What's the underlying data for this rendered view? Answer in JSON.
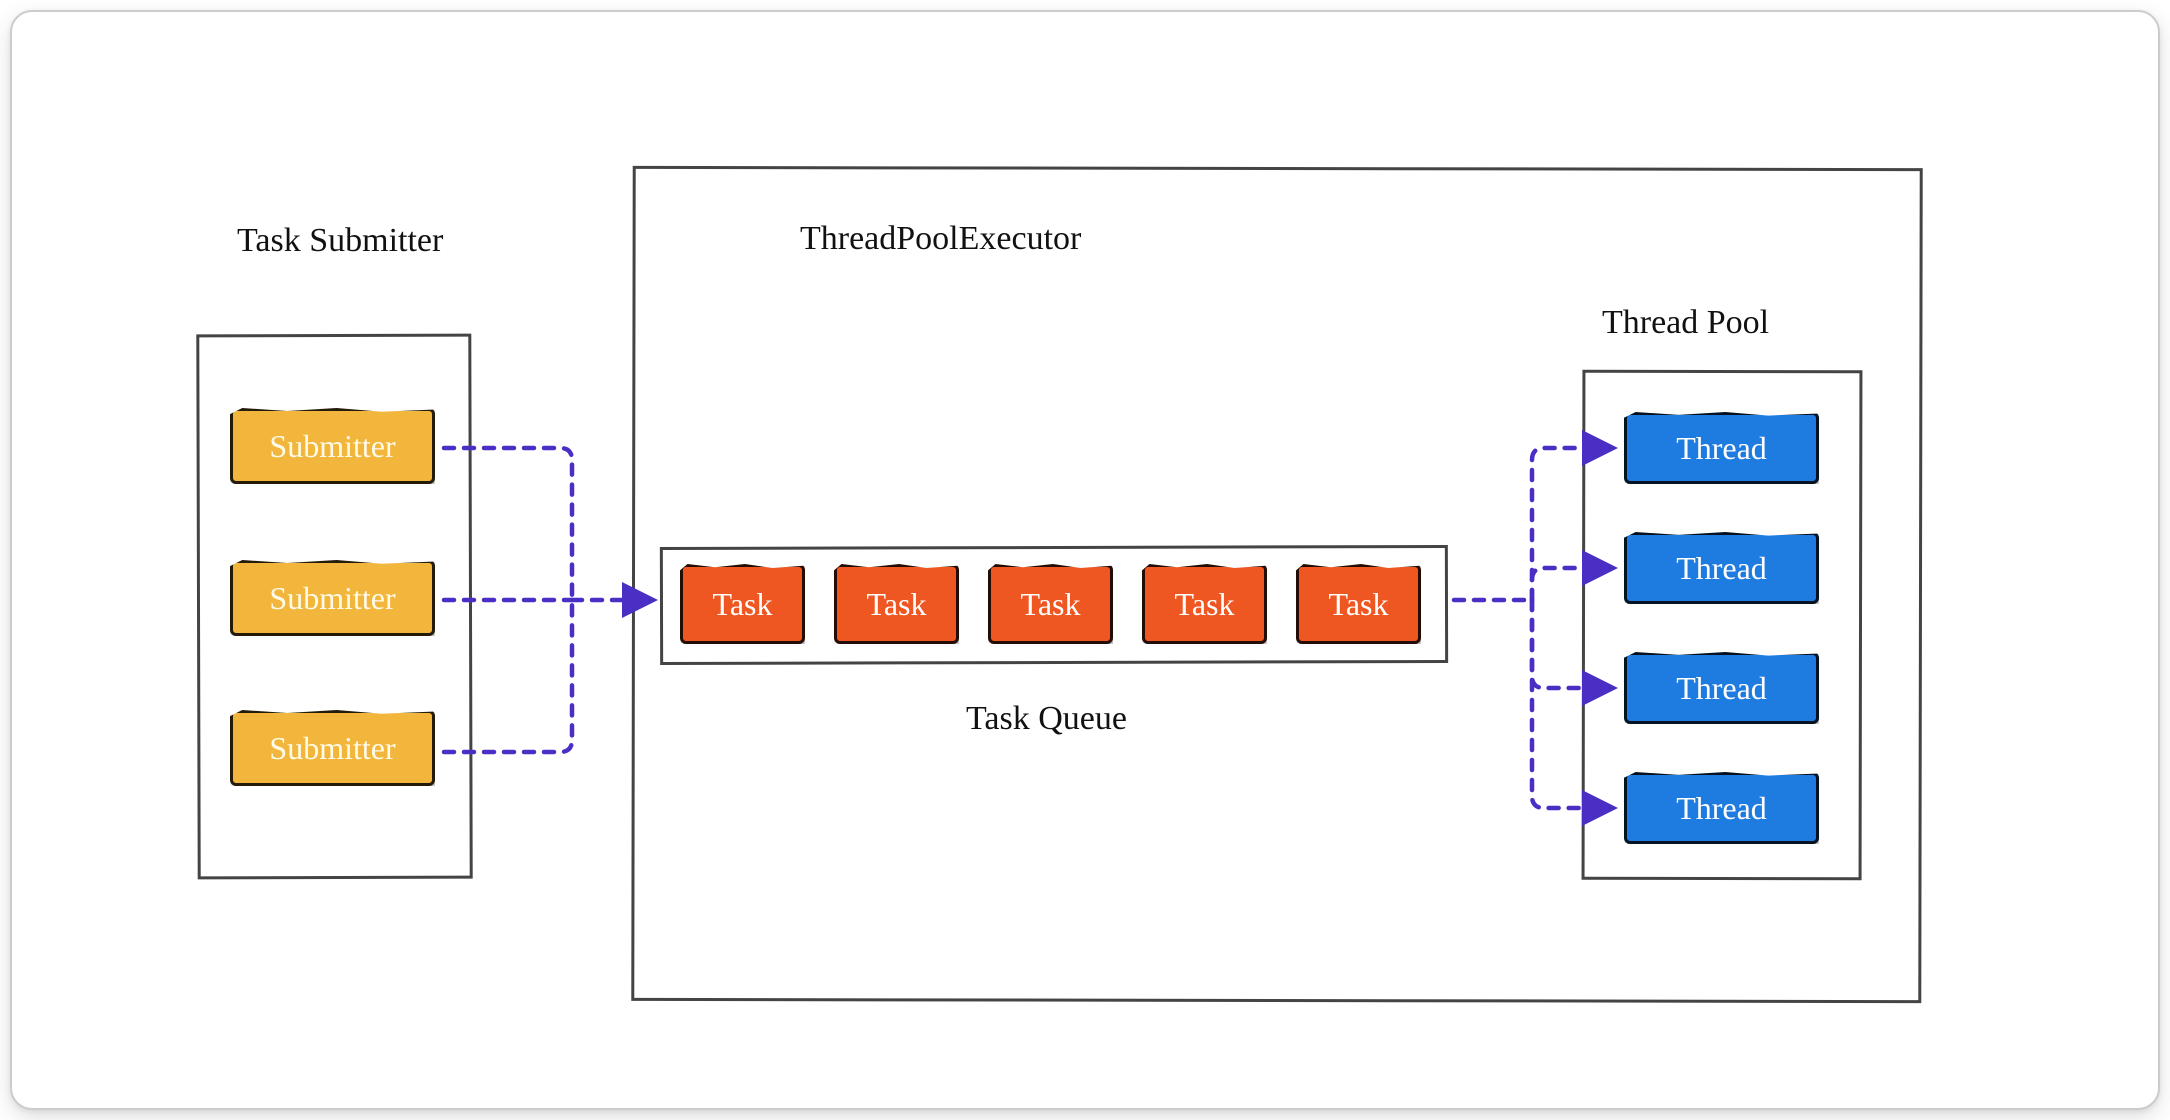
{
  "labels": {
    "task_submitter_title": "Task Submitter",
    "executor_title": "ThreadPoolExecutor",
    "thread_pool_title": "Thread Pool",
    "task_queue_title": "Task Queue"
  },
  "submitters": [
    {
      "label": "Submitter"
    },
    {
      "label": "Submitter"
    },
    {
      "label": "Submitter"
    }
  ],
  "task_queue": [
    {
      "label": "Task"
    },
    {
      "label": "Task"
    },
    {
      "label": "Task"
    },
    {
      "label": "Task"
    },
    {
      "label": "Task"
    }
  ],
  "threads": [
    {
      "label": "Thread"
    },
    {
      "label": "Thread"
    },
    {
      "label": "Thread"
    },
    {
      "label": "Thread"
    }
  ],
  "colors": {
    "submitter": "#f2b63c",
    "task": "#ee5622",
    "thread": "#1e7ce0",
    "connector": "#4b2fc4"
  }
}
